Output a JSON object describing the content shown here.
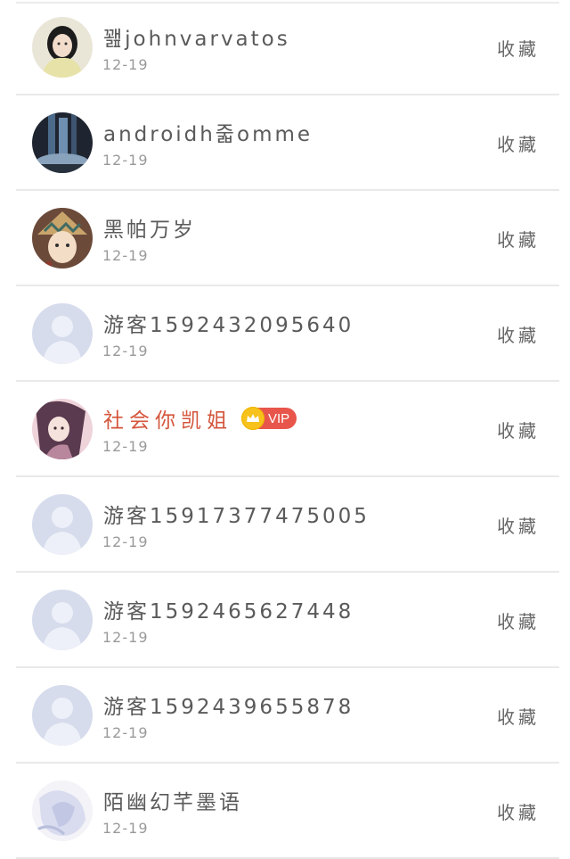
{
  "items": [
    {
      "name": "꽲johnvarvatos",
      "date": "12-19",
      "action": "收藏",
      "avatar": "girl-photo",
      "vip": false
    },
    {
      "name": "androidh줇omme",
      "date": "12-19",
      "action": "收藏",
      "avatar": "waterfall-photo",
      "vip": false
    },
    {
      "name": "黑帕万岁",
      "date": "12-19",
      "action": "收藏",
      "avatar": "anime-warrior",
      "vip": false
    },
    {
      "name": "游客15924320956​40",
      "date": "12-19",
      "action": "收藏",
      "avatar": "default-user",
      "vip": false
    },
    {
      "name": "社会你凯姐",
      "date": "12-19",
      "action": "收藏",
      "avatar": "anime-girl",
      "vip": true,
      "vip_label": "VIP"
    },
    {
      "name": "游客15917377475005",
      "date": "12-19",
      "action": "收藏",
      "avatar": "default-user",
      "vip": false
    },
    {
      "name": "游客15924656274​48",
      "date": "12-19",
      "action": "收藏",
      "avatar": "default-user",
      "vip": false
    },
    {
      "name": "游客15924396558​78",
      "date": "12-19",
      "action": "收藏",
      "avatar": "default-user",
      "vip": false
    },
    {
      "name": "陌幽幻芊墨语",
      "date": "12-19",
      "action": "收藏",
      "avatar": "pale-illustration",
      "vip": false
    }
  ],
  "colors": {
    "vip_name": "#d4553b",
    "vip_badge": "#e8554a",
    "crown": "#f6c21b",
    "divider": "#e9e9e9"
  }
}
